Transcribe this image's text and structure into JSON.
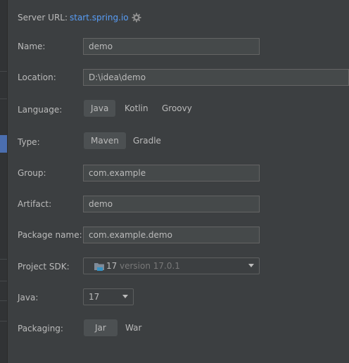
{
  "server": {
    "label": "Server URL:",
    "url": "start.spring.io",
    "settings_icon": "gear-icon"
  },
  "name": {
    "label": "Name:",
    "value": "demo"
  },
  "location": {
    "label": "Location:",
    "value": "D:\\idea\\demo"
  },
  "language": {
    "label": "Language:",
    "options": [
      "Java",
      "Kotlin",
      "Groovy"
    ],
    "selected": "Java"
  },
  "type": {
    "label": "Type:",
    "options": [
      "Maven",
      "Gradle"
    ],
    "selected": "Maven"
  },
  "group": {
    "label": "Group:",
    "value": "com.example"
  },
  "artifact": {
    "label": "Artifact:",
    "value": "demo"
  },
  "package_name": {
    "label": "Package name:",
    "value": "com.example.demo"
  },
  "project_sdk": {
    "label": "Project SDK:",
    "version": "17",
    "detail": "version 17.0.1",
    "icon": "folder-icon"
  },
  "java": {
    "label": "Java:",
    "value": "17"
  },
  "packaging": {
    "label": "Packaging:",
    "options": [
      "Jar",
      "War"
    ],
    "selected": "Jar"
  },
  "colors": {
    "background": "#3c3f41",
    "link": "#589df6",
    "field": "#45494a",
    "selected_segment": "#4c5052",
    "sidebar_selection": "#4b6eaf"
  }
}
